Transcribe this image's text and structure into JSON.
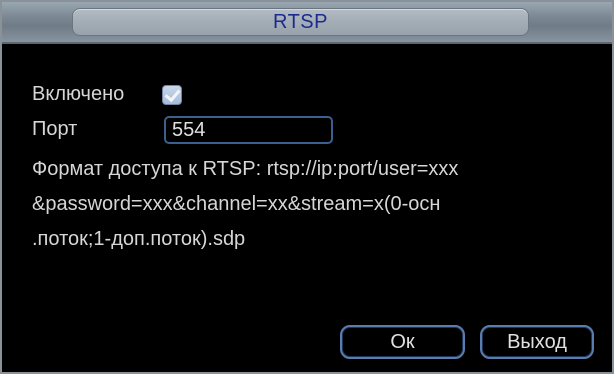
{
  "window": {
    "title": "RTSP"
  },
  "form": {
    "enabled_label": "Включено",
    "enabled_checked": true,
    "port_label": "Порт",
    "port_value": "554"
  },
  "description": {
    "lines": [
      "Формат доступа к RTSP: rtsp://ip:port/user=xxx",
      "&password=xxx&channel=xx&stream=x(0-осн",
      ".поток;1-доп.поток).sdp"
    ]
  },
  "buttons": {
    "ok_label": "Ок",
    "exit_label": "Выход"
  },
  "colors": {
    "title_text": "#1c2a8f",
    "accent_border": "#5a7db0",
    "text": "#d6d6d6",
    "background": "#000000"
  },
  "icons": {
    "enabled_checkbox": "checkmark-icon"
  }
}
